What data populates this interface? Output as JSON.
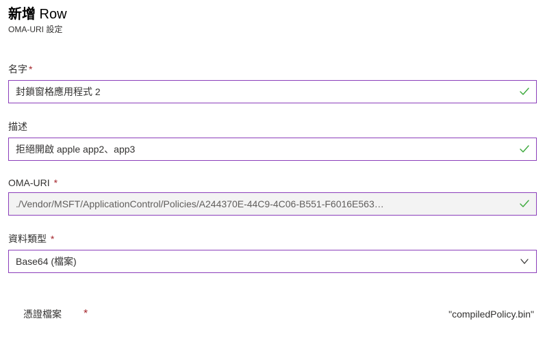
{
  "header": {
    "title_prefix": "新增",
    "title_rest": " Row",
    "subtitle": "OMA-URI 設定"
  },
  "fields": {
    "name": {
      "label": "名字",
      "required": "*",
      "value": "封鎖窗格應用程式 2"
    },
    "description": {
      "label": "描述",
      "value": "拒絕開啟 apple app2、app3"
    },
    "oma_uri": {
      "label": "OMA-URI ",
      "required": "*",
      "value": "./Vendor/MSFT/ApplicationControl/Policies/A244370E-44C9-4C06-B551-F6016E563…"
    },
    "data_type": {
      "label": "資料類型 ",
      "required": "*",
      "value": "Base64 (檔案)"
    },
    "certificate_file": {
      "label": "憑證檔案",
      "required": "*",
      "filename": "\"compiledPolicy.bin\""
    }
  }
}
